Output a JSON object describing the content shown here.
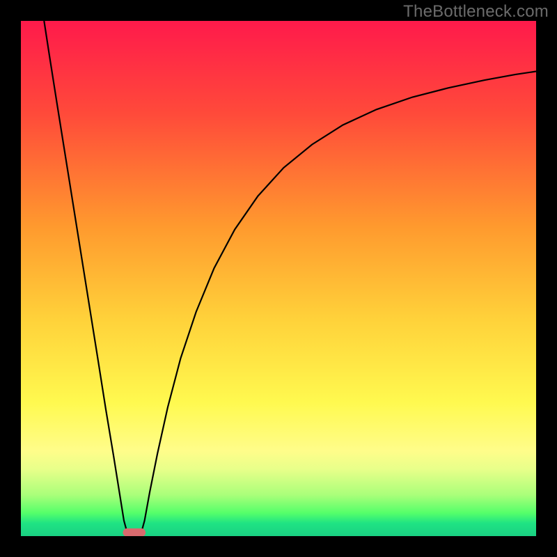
{
  "watermark": "TheBottleneck.com",
  "chart_data": {
    "type": "line",
    "title": "",
    "xlabel": "",
    "ylabel": "",
    "xlim": [
      0,
      100
    ],
    "ylim": [
      0,
      100
    ],
    "grid": false,
    "background_gradient": {
      "stops": [
        {
          "offset": 0.0,
          "color": "#ff1a4b"
        },
        {
          "offset": 0.18,
          "color": "#ff4a3a"
        },
        {
          "offset": 0.4,
          "color": "#ff9a2e"
        },
        {
          "offset": 0.58,
          "color": "#ffd23a"
        },
        {
          "offset": 0.74,
          "color": "#fff94f"
        },
        {
          "offset": 0.835,
          "color": "#fffd8a"
        },
        {
          "offset": 0.87,
          "color": "#e8ff8a"
        },
        {
          "offset": 0.92,
          "color": "#aaff7a"
        },
        {
          "offset": 0.955,
          "color": "#55ff6a"
        },
        {
          "offset": 0.975,
          "color": "#1fe383"
        },
        {
          "offset": 1.0,
          "color": "#1ad183"
        }
      ]
    },
    "series": [
      {
        "name": "bottleneck-curve",
        "color": "#000000",
        "points": [
          {
            "x": 4.5,
            "y": 100.0
          },
          {
            "x": 5.5,
            "y": 93.5
          },
          {
            "x": 7.0,
            "y": 84.0
          },
          {
            "x": 9.0,
            "y": 71.5
          },
          {
            "x": 11.0,
            "y": 59.0
          },
          {
            "x": 13.0,
            "y": 46.5
          },
          {
            "x": 15.0,
            "y": 34.0
          },
          {
            "x": 16.5,
            "y": 24.5
          },
          {
            "x": 18.0,
            "y": 15.5
          },
          {
            "x": 19.2,
            "y": 8.0
          },
          {
            "x": 20.0,
            "y": 3.0
          },
          {
            "x": 20.6,
            "y": 0.8
          },
          {
            "x": 21.3,
            "y": 0.6
          },
          {
            "x": 22.0,
            "y": 0.6
          },
          {
            "x": 22.7,
            "y": 0.6
          },
          {
            "x": 23.4,
            "y": 0.8
          },
          {
            "x": 24.0,
            "y": 3.0
          },
          {
            "x": 25.0,
            "y": 8.5
          },
          {
            "x": 26.5,
            "y": 16.0
          },
          {
            "x": 28.5,
            "y": 25.0
          },
          {
            "x": 31.0,
            "y": 34.5
          },
          {
            "x": 34.0,
            "y": 43.5
          },
          {
            "x": 37.5,
            "y": 52.0
          },
          {
            "x": 41.5,
            "y": 59.5
          },
          {
            "x": 46.0,
            "y": 66.0
          },
          {
            "x": 51.0,
            "y": 71.5
          },
          {
            "x": 56.5,
            "y": 76.0
          },
          {
            "x": 62.5,
            "y": 79.8
          },
          {
            "x": 69.0,
            "y": 82.8
          },
          {
            "x": 76.0,
            "y": 85.2
          },
          {
            "x": 83.0,
            "y": 87.0
          },
          {
            "x": 90.0,
            "y": 88.5
          },
          {
            "x": 96.0,
            "y": 89.6
          },
          {
            "x": 100.0,
            "y": 90.2
          }
        ]
      }
    ],
    "marker": {
      "name": "optimal-zone",
      "shape": "stadium",
      "x_center": 22.0,
      "half_width": 2.2,
      "y": 0.7,
      "height": 1.6,
      "fill": "#d86a6e"
    }
  }
}
